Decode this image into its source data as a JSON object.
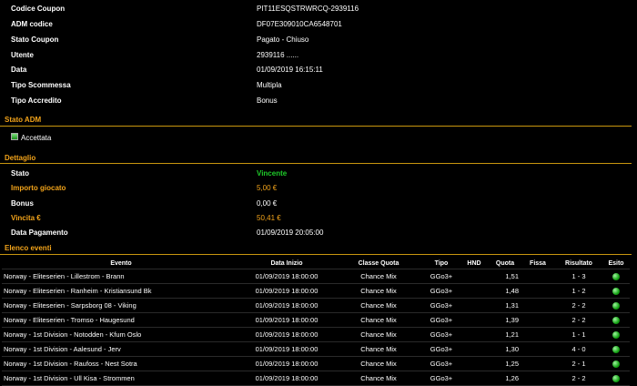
{
  "coupon": {
    "rows": [
      {
        "label": "Codice Coupon",
        "value": "PIT11ESQSTRWRCQ-2939116"
      },
      {
        "label": "ADM codice",
        "value": "DF07E309010CA6548701"
      },
      {
        "label": "Stato Coupon",
        "value": "Pagato - Chiuso"
      },
      {
        "label": "Utente",
        "value": "2939116 ......"
      },
      {
        "label": "Data",
        "value": "01/09/2019 16:15:11"
      },
      {
        "label": "Tipo Scommessa",
        "value": "Multipla"
      },
      {
        "label": "Tipo Accredito",
        "value": "Bonus"
      }
    ]
  },
  "stato_adm": {
    "title": "Stato ADM",
    "status": "Accettata"
  },
  "dettaglio": {
    "title": "Dettaglio",
    "rows": [
      {
        "label": "Stato",
        "value": "Vincente"
      },
      {
        "label": "Importo giocato",
        "value": "5,00 €"
      },
      {
        "label": "Bonus",
        "value": "0,00 €"
      },
      {
        "label": "Vincita €",
        "value": "50,41 €"
      },
      {
        "label": "Data Pagamento",
        "value": "01/09/2019 20:05:00"
      }
    ]
  },
  "eventi": {
    "title": "Elenco eventi",
    "headers": [
      "Evento",
      "Data Inizio",
      "Classe Quota",
      "Tipo",
      "HND",
      "Quota",
      "Fissa",
      "Risultato",
      "Esito"
    ],
    "rows": [
      {
        "evento": "Norway - Eliteserien - Lillestrom - Brann",
        "data": "01/09/2019 18:00:00",
        "classe": "Chance Mix",
        "tipo": "GGo3+",
        "hnd": "",
        "quota": "1,51",
        "fissa": "",
        "risultato": "1 - 3"
      },
      {
        "evento": "Norway - Eliteserien - Ranheim - Kristiansund Bk",
        "data": "01/09/2019 18:00:00",
        "classe": "Chance Mix",
        "tipo": "GGo3+",
        "hnd": "",
        "quota": "1,48",
        "fissa": "",
        "risultato": "1 - 2"
      },
      {
        "evento": "Norway - Eliteserien - Sarpsborg 08 - Viking",
        "data": "01/09/2019 18:00:00",
        "classe": "Chance Mix",
        "tipo": "GGo3+",
        "hnd": "",
        "quota": "1,31",
        "fissa": "",
        "risultato": "2 - 2"
      },
      {
        "evento": "Norway - Eliteserien - Tromso - Haugesund",
        "data": "01/09/2019 18:00:00",
        "classe": "Chance Mix",
        "tipo": "GGo3+",
        "hnd": "",
        "quota": "1,39",
        "fissa": "",
        "risultato": "2 - 2"
      },
      {
        "evento": "Norway - 1st Division - Notodden - Kfum Oslo",
        "data": "01/09/2019 18:00:00",
        "classe": "Chance Mix",
        "tipo": "GGo3+",
        "hnd": "",
        "quota": "1,21",
        "fissa": "",
        "risultato": "1 - 1"
      },
      {
        "evento": "Norway - 1st Division - Aalesund - Jerv",
        "data": "01/09/2019 18:00:00",
        "classe": "Chance Mix",
        "tipo": "GGo3+",
        "hnd": "",
        "quota": "1,30",
        "fissa": "",
        "risultato": "4 - 0"
      },
      {
        "evento": "Norway - 1st Division - Raufoss - Nest Sotra",
        "data": "01/09/2019 18:00:00",
        "classe": "Chance Mix",
        "tipo": "GGo3+",
        "hnd": "",
        "quota": "1,25",
        "fissa": "",
        "risultato": "2 - 1"
      },
      {
        "evento": "Norway - 1st Division - Ull Kisa - Strommen",
        "data": "01/09/2019 18:00:00",
        "classe": "Chance Mix",
        "tipo": "GGo3+",
        "hnd": "",
        "quota": "1,26",
        "fissa": "",
        "risultato": "2 - 2"
      }
    ]
  },
  "colors": {
    "accent": "#f2a31a",
    "win": "#1fcc2a",
    "background": "#000000"
  }
}
